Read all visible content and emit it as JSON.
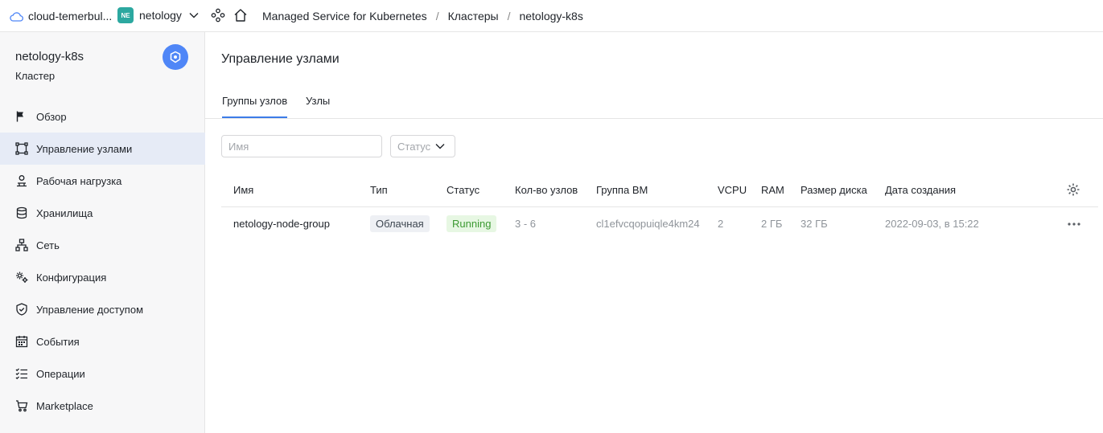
{
  "topbar": {
    "cloud_name": "cloud-temerbul...",
    "folder_badge": "NE",
    "folder_name": "netology",
    "breadcrumbs": [
      "Managed Service for Kubernetes",
      "Кластеры",
      "netology-k8s"
    ]
  },
  "sidebar": {
    "title": "netology-k8s",
    "subtitle": "Кластер",
    "items": [
      {
        "label": "Обзор",
        "icon": "flag-icon"
      },
      {
        "label": "Управление узлами",
        "icon": "nodes-icon",
        "active": true
      },
      {
        "label": "Рабочая нагрузка",
        "icon": "workload-icon"
      },
      {
        "label": "Хранилища",
        "icon": "database-icon"
      },
      {
        "label": "Сеть",
        "icon": "network-icon"
      },
      {
        "label": "Конфигурация",
        "icon": "config-icon"
      },
      {
        "label": "Управление доступом",
        "icon": "shield-icon"
      },
      {
        "label": "События",
        "icon": "calendar-icon"
      },
      {
        "label": "Операции",
        "icon": "list-icon"
      },
      {
        "label": "Marketplace",
        "icon": "cart-icon"
      }
    ]
  },
  "main": {
    "title": "Управление узлами",
    "tabs": [
      {
        "label": "Группы узлов",
        "active": true
      },
      {
        "label": "Узлы",
        "active": false
      }
    ],
    "filters": {
      "name_placeholder": "Имя",
      "status_label": "Статус"
    },
    "table": {
      "columns": [
        "Имя",
        "Тип",
        "Статус",
        "Кол-во узлов",
        "Группа ВМ",
        "VCPU",
        "RAM",
        "Размер диска",
        "Дата создания"
      ],
      "rows": [
        {
          "name": "netology-node-group",
          "type": "Облачная",
          "status": "Running",
          "node_count": "3 - 6",
          "vm_group": "cl1efvcqopuiqle4km24",
          "vcpu": "2",
          "ram": "2 ГБ",
          "disk": "32 ГБ",
          "created": "2022-09-03, в 15:22"
        }
      ]
    }
  },
  "colors": {
    "accent": "#3c7ce8",
    "active_nav_bg": "#e6ebf6",
    "badge_blue": "#4f86f7",
    "folder_badge_bg": "#2ca8a0",
    "status_running_bg": "#e7f7e3",
    "status_running_text": "#3d9a33"
  }
}
